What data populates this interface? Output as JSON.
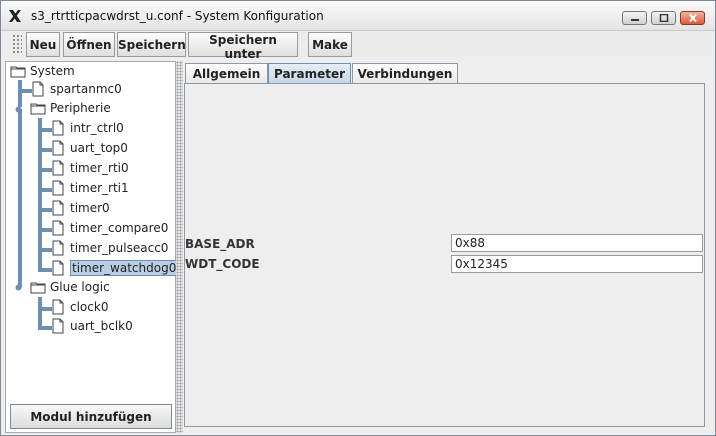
{
  "window": {
    "title": "s3_rtrtticpacwdrst_u.conf - System Konfiguration",
    "icon": "x-window-icon"
  },
  "toolbar": {
    "new_label": "Neu",
    "open_label": "Öffnen",
    "save_label": "Speichern",
    "save_as_label": "Speichern unter",
    "make_label": "Make"
  },
  "tree": {
    "root": "System",
    "nodes": [
      {
        "label": "spartanmc0"
      },
      {
        "label": "Peripherie",
        "children": [
          "intr_ctrl0",
          "uart_top0",
          "timer_rti0",
          "timer_rti1",
          "timer0",
          "timer_compare0",
          "timer_pulseacc0",
          "timer_watchdog0"
        ]
      },
      {
        "label": "Glue logic",
        "children": [
          "clock0",
          "uart_bclk0"
        ]
      }
    ],
    "selected": "timer_watchdog0"
  },
  "left_panel": {
    "add_module_label": "Modul hinzufügen"
  },
  "tabs": {
    "general": "Allgemein",
    "parameter": "Parameter",
    "connections": "Verbindungen",
    "active": "Parameter"
  },
  "parameters": [
    {
      "name": "BASE_ADR",
      "value": "0x88"
    },
    {
      "name": "WDT_CODE",
      "value": "0x12345"
    }
  ]
}
